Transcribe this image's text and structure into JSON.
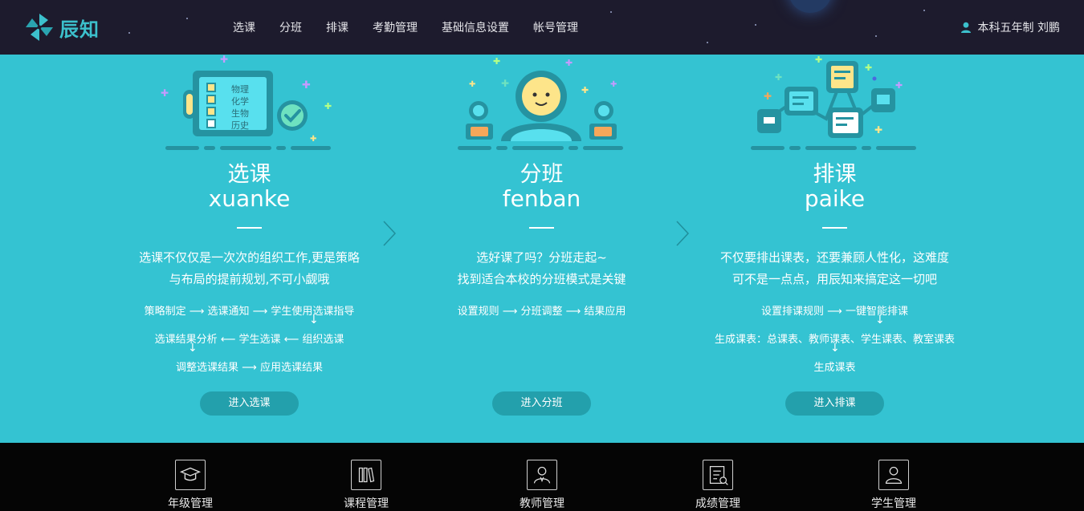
{
  "header": {
    "logo_text": "辰知",
    "nav": [
      {
        "label": "选课"
      },
      {
        "label": "分班"
      },
      {
        "label": "排课"
      },
      {
        "label": "考勤管理"
      },
      {
        "label": "基础信息设置"
      },
      {
        "label": "帐号管理"
      }
    ],
    "user": "本科五年制 刘鹏"
  },
  "columns": [
    {
      "title_cn": "选课",
      "title_en": "xuanke",
      "desc": [
        "选课不仅仅是一次次的组织工作,更是策略",
        "与布局的提前规划,不可小觑哦"
      ],
      "flow": [
        "策略制定 ⟶ 选课通知 ⟶ 学生使用选课指导",
        "选课结果分析 ⟵ 学生选课 ⟵ 组织选课",
        "调整选课结果 ⟶ 应用选课结果"
      ],
      "subjects": [
        "物理",
        "化学",
        "生物",
        "历史"
      ],
      "button": "进入选课"
    },
    {
      "title_cn": "分班",
      "title_en": "fenban",
      "desc": [
        "选好课了吗？分班走起~",
        "找到适合本校的分班模式是关键"
      ],
      "flow": [
        "设置规则 ⟶ 分班调整 ⟶ 结果应用"
      ],
      "button": "进入分班"
    },
    {
      "title_cn": "排课",
      "title_en": "paike",
      "desc": [
        "不仅要排出课表，还要兼顾人性化，这难度",
        "可不是一点点，用辰知来搞定这一切吧"
      ],
      "flow": [
        "设置排课规则 ⟶ 一键智能排课",
        "生成课表：总课表、教师课表、学生课表、教室课表",
        "生成课表"
      ],
      "button": "进入排课"
    }
  ],
  "dock": [
    {
      "label": "年级管理",
      "icon": "graduation-cap-icon"
    },
    {
      "label": "课程管理",
      "icon": "books-icon"
    },
    {
      "label": "教师管理",
      "icon": "teacher-icon"
    },
    {
      "label": "成绩管理",
      "icon": "grade-report-icon"
    },
    {
      "label": "学生管理",
      "icon": "student-icon"
    }
  ],
  "colors": {
    "header_bg": "#1d1b2d",
    "main_bg": "#34c3d2",
    "button_bg": "#23a0ac",
    "dock_bg": "#050505",
    "accent": "#3cc0cc"
  }
}
